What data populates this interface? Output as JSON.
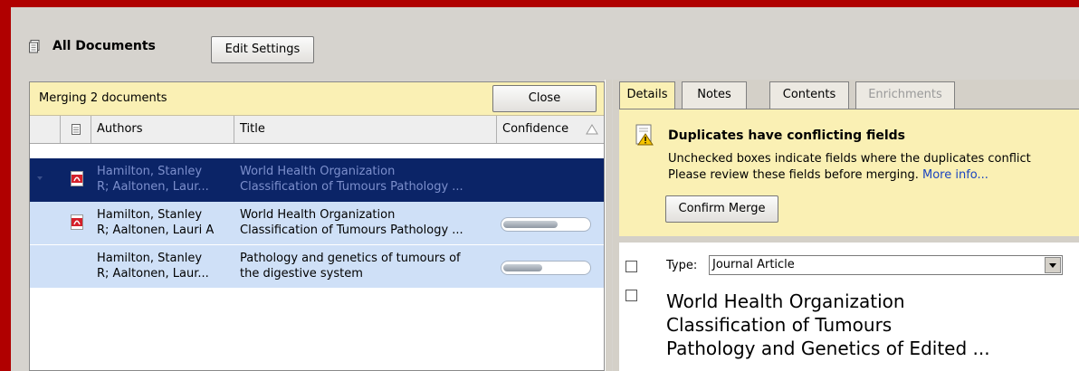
{
  "header": {
    "title": "All Documents",
    "edit_settings": "Edit Settings"
  },
  "merge_bar": {
    "message": "Merging 2 documents",
    "close": "Close"
  },
  "columns": {
    "authors": "Authors",
    "title": "Title",
    "confidence": "Confidence"
  },
  "rows": [
    {
      "authors_l1": "Hamilton, Stanley",
      "authors_l2": "R; Aaltonen, Laur...",
      "title_l1": "World Health Organization",
      "title_l2": "Classification of Tumours Pathology ...",
      "confidence": null
    },
    {
      "authors_l1": "Hamilton, Stanley",
      "authors_l2": "R; Aaltonen, Lauri A",
      "title_l1": "World Health Organization",
      "title_l2": "Classification of Tumours Pathology ...",
      "confidence": 0.62
    },
    {
      "authors_l1": "Hamilton, Stanley",
      "authors_l2": "R; Aaltonen, Laur...",
      "title_l1": "Pathology and genetics of tumours of",
      "title_l2": "the digestive system",
      "confidence": 0.45
    }
  ],
  "tabs": [
    {
      "label": "Details",
      "state": "active"
    },
    {
      "label": "Notes",
      "state": "normal"
    },
    {
      "label": "Contents",
      "state": "normal"
    },
    {
      "label": "Enrichments",
      "state": "disabled"
    }
  ],
  "notice": {
    "title": "Duplicates have conflicting fields",
    "line1": "Unchecked boxes indicate fields where the duplicates conflict",
    "line2": "Please review these fields before merging.",
    "more_info": "More info...",
    "confirm": "Confirm Merge"
  },
  "details": {
    "type_label": "Type:",
    "type_value": "Journal Article",
    "title_l1": "World Health Organization",
    "title_l2": "Classification of Tumours",
    "title_l3": "Pathology and Genetics of Edited ..."
  },
  "colors": {
    "frame": "#b00000",
    "selection": "#0b2467",
    "alt_row": "#cfe0f7",
    "notice_bg": "#faf0b4",
    "link": "#1a44c0"
  }
}
